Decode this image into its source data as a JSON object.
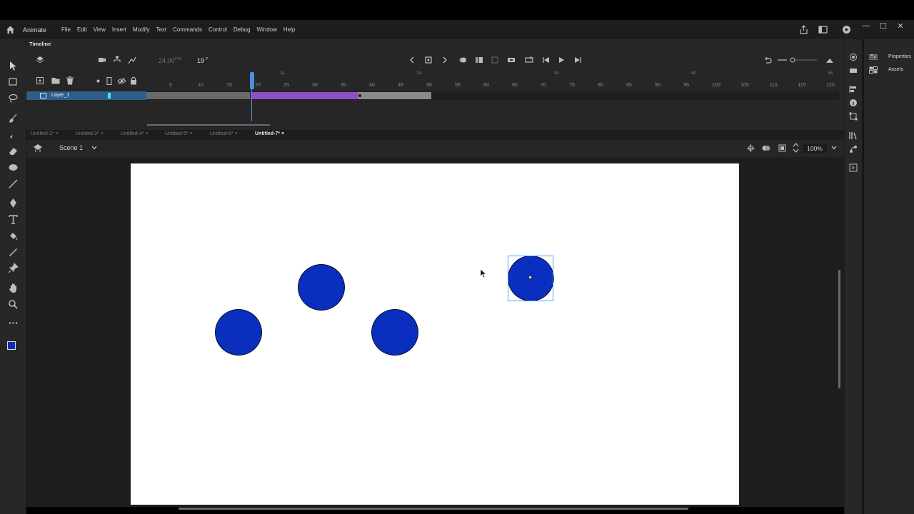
{
  "app": {
    "name": "Animate"
  },
  "menu": [
    "File",
    "Edit",
    "View",
    "Insert",
    "Modify",
    "Text",
    "Commands",
    "Control",
    "Debug",
    "Window",
    "Help"
  ],
  "timeline": {
    "title": "Timeline",
    "fps": "24.00",
    "fps_unit": "FPS",
    "current_frame": "19",
    "frame_unit": "F",
    "layer_name": "Layer_1",
    "seconds_marks": [
      "1s",
      "2s",
      "3s",
      "4s",
      "5s"
    ],
    "frame_numbers": [
      "5",
      "10",
      "15",
      "20",
      "25",
      "30",
      "35",
      "40",
      "45",
      "50",
      "55",
      "60",
      "65",
      "70",
      "75",
      "80",
      "85",
      "90",
      "95",
      "100",
      "105",
      "110",
      "115",
      "120"
    ]
  },
  "tabs": [
    "Untitled-2*",
    "Untitled-3*",
    "Untitled-4*",
    "Untitled-5*",
    "Untitled-6*",
    "Untitled-7*"
  ],
  "active_tab": "Untitled-7*",
  "tab_close": "×",
  "editbar": {
    "scene": "Scene 1",
    "zoom": "100%"
  },
  "right_panel": {
    "properties": "Properties",
    "assets": "Assets"
  },
  "window_controls": [
    "—",
    "☐",
    "✕"
  ],
  "colors": {
    "ball_fill": "#0a2fbf",
    "tween_span": "#8b4fc8",
    "layer_highlight": "#2d5f8a",
    "playhead": "#4a90e2",
    "stage": "#ffffff"
  },
  "icons": [
    "home-icon",
    "share-icon",
    "panel-icon",
    "play-icon",
    "layers-icon",
    "camera-icon",
    "hierarchy-icon",
    "graph-icon",
    "prev-keyframe-icon",
    "next-keyframe-icon",
    "rewind-icon",
    "step-back-icon",
    "play-button-icon",
    "step-forward-icon",
    "selection-tool-icon",
    "brush-icon",
    "zoom-tool-icon",
    "hand-tool-icon"
  ]
}
